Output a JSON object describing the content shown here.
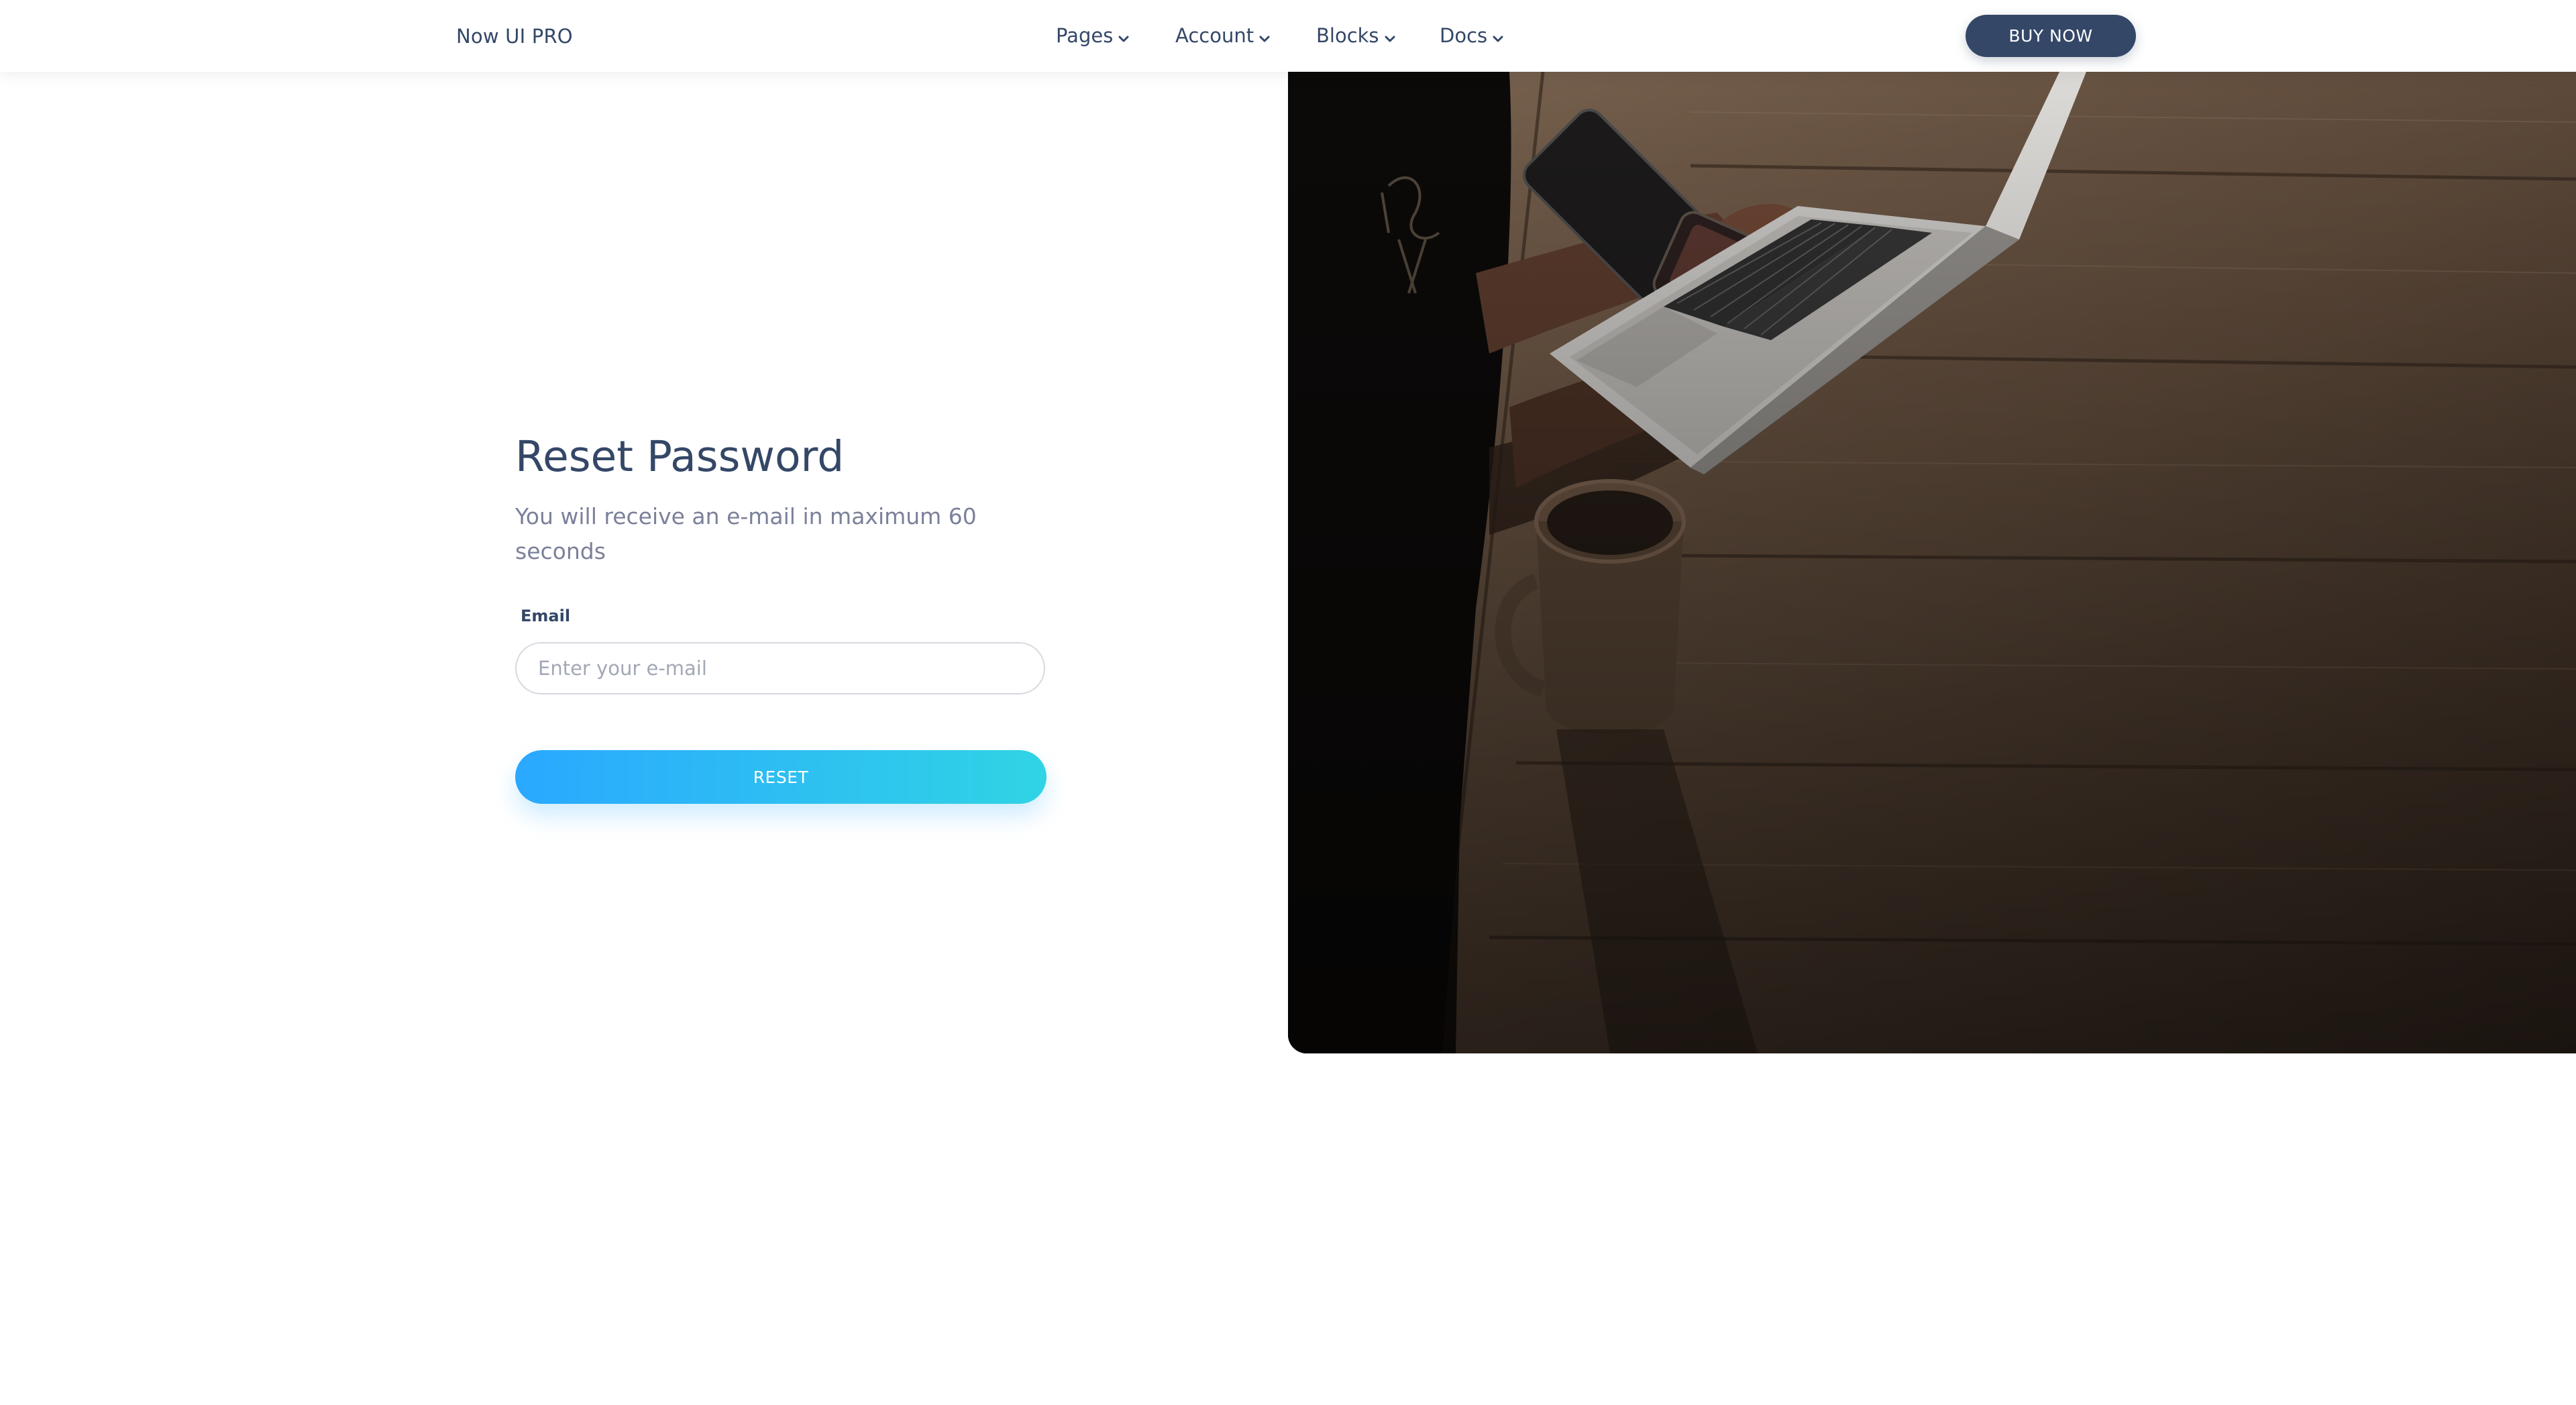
{
  "navbar": {
    "brand": "Now UI PRO",
    "links": [
      {
        "label": "Pages",
        "icon": "chevron-down-icon"
      },
      {
        "label": "Account",
        "icon": "chevron-down-icon"
      },
      {
        "label": "Blocks",
        "icon": "chevron-down-icon"
      },
      {
        "label": "Docs",
        "icon": "chevron-down-icon"
      }
    ],
    "cta_label": "BUY NOW"
  },
  "form": {
    "title": "Reset Password",
    "subtitle": "You will receive an e-mail in maximum 60 seconds",
    "email_label": "Email",
    "email_value": "",
    "email_placeholder": "Enter your e-mail",
    "submit_label": "RESET"
  },
  "colors": {
    "primary_dark": "#344767",
    "muted_text": "#7b809a",
    "reset_gradient_start": "#2aa8ff",
    "reset_gradient_end": "#30d4e5"
  }
}
